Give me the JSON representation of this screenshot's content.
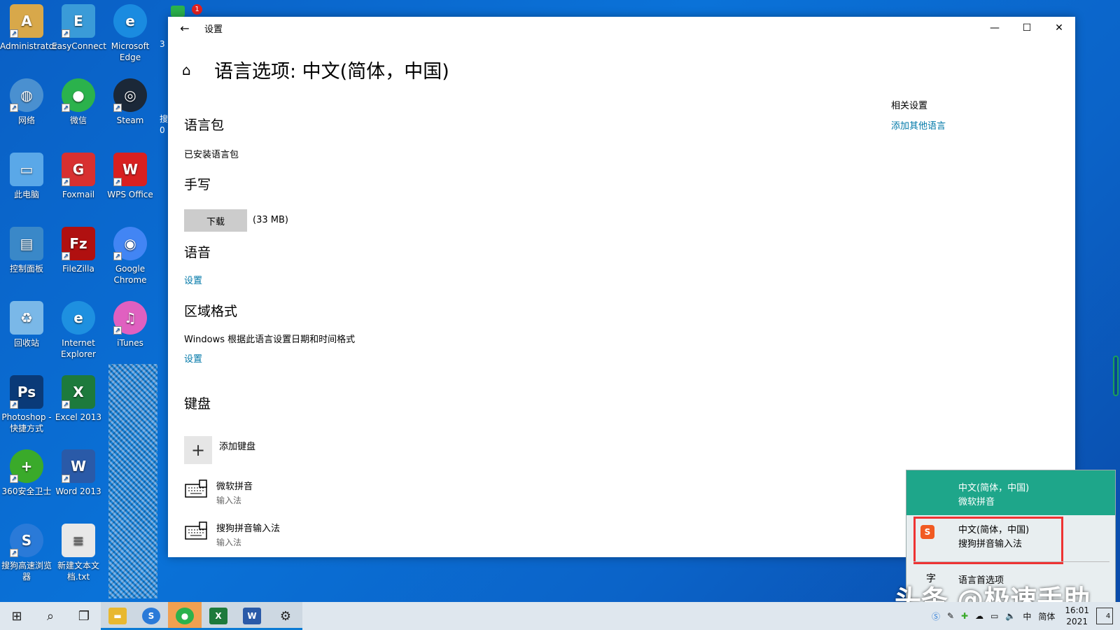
{
  "desktop": {
    "icons": [
      {
        "label": "Administrator",
        "icon": "user-folder-icon",
        "color": "#d8a84a"
      },
      {
        "label": "EasyConnect",
        "icon": "easyconnect-icon",
        "color": "#3a9bd8"
      },
      {
        "label": "Microsoft Edge",
        "icon": "edge-icon",
        "color": "#1a8be0"
      },
      {
        "label": "网络",
        "icon": "network-icon",
        "color": "#4a90d0"
      },
      {
        "label": "微信",
        "icon": "wechat-icon",
        "color": "#2bb24c"
      },
      {
        "label": "Steam",
        "icon": "steam-icon",
        "color": "#1b2838"
      },
      {
        "label": "此电脑",
        "icon": "computer-icon",
        "color": "#5aa8e8"
      },
      {
        "label": "Foxmail",
        "icon": "foxmail-icon",
        "color": "#d83030"
      },
      {
        "label": "WPS Office",
        "icon": "wps-icon",
        "color": "#d82020"
      },
      {
        "label": "控制面板",
        "icon": "control-panel-icon",
        "color": "#3a88c8"
      },
      {
        "label": "FileZilla",
        "icon": "filezilla-icon",
        "color": "#b01010"
      },
      {
        "label": "Google Chrome",
        "icon": "chrome-icon",
        "color": "#4285f4"
      },
      {
        "label": "回收站",
        "icon": "recycle-bin-icon",
        "color": "#7ab8e8"
      },
      {
        "label": "Internet Explorer",
        "icon": "ie-icon",
        "color": "#1e90e0"
      },
      {
        "label": "iTunes",
        "icon": "itunes-icon",
        "color": "#e060c0"
      },
      {
        "label": "Photoshop - 快捷方式",
        "icon": "photoshop-icon",
        "color": "#0a3a78"
      },
      {
        "label": "Excel 2013",
        "icon": "excel-icon",
        "color": "#1d7a3c"
      },
      {
        "label": "360安全卫士",
        "icon": "360-icon",
        "color": "#3aaa2a"
      },
      {
        "label": "Word 2013",
        "icon": "word-icon",
        "color": "#2a5aa8"
      },
      {
        "label": "搜狗高速浏览器",
        "icon": "sogou-browser-icon",
        "color": "#2a7ad8"
      },
      {
        "label": "新建文本文档.txt",
        "icon": "text-file-icon",
        "color": "#e8e8e8"
      }
    ],
    "partial_labels": [
      "3",
      "搜",
      "0"
    ],
    "badge_count": "1"
  },
  "window": {
    "title": "设置",
    "page_title": "语言选项: 中文(简体，中国)",
    "sections": {
      "language_pack": {
        "title": "语言包",
        "status": "已安装语言包"
      },
      "handwriting": {
        "title": "手写",
        "download_label": "下载",
        "size": "(33 MB)"
      },
      "speech": {
        "title": "语音",
        "link": "设置"
      },
      "regional": {
        "title": "区域格式",
        "desc": "Windows 根据此语言设置日期和时间格式",
        "link": "设置"
      },
      "keyboard": {
        "title": "键盘",
        "add_label": "添加键盘",
        "items": [
          {
            "name": "微软拼音",
            "type": "输入法"
          },
          {
            "name": "搜狗拼音输入法",
            "type": "输入法"
          }
        ]
      }
    },
    "related": {
      "title": "相关设置",
      "link": "添加其他语言"
    }
  },
  "flyout": {
    "options": [
      {
        "line1": "中文(简体，中国)",
        "line2": "微软拼音"
      },
      {
        "line1": "中文(简体，中国)",
        "line2": "搜狗拼音输入法"
      }
    ],
    "prefs_icon": "字",
    "prefs_label": "语言首选项"
  },
  "taskbar": {
    "tray_ime": "中",
    "tray_mode": "简体",
    "time": "16:01",
    "date": "2021",
    "notify_count": "4"
  },
  "watermark": "头条 @极速手助",
  "colors": {
    "accent": "#0078a8",
    "flyout_selected": "#1ea68a",
    "highlight_box": "#e33333"
  }
}
